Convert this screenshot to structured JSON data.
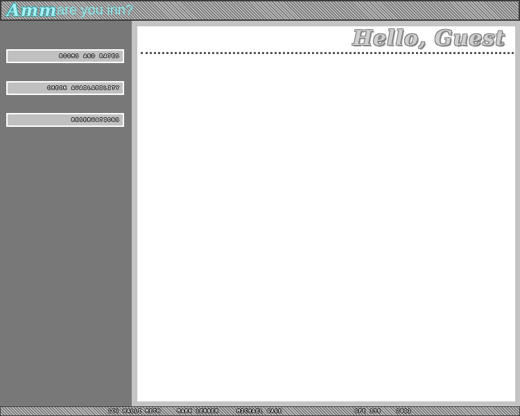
{
  "header": {
    "logo_text": "Amm",
    "tagline": "are you inn?"
  },
  "nav": {
    "items": [
      {
        "label": "ROOMS AND RATES"
      },
      {
        "label": "CHECK AVAILABILITY"
      },
      {
        "label": "RESERVATIONS"
      }
    ]
  },
  "main": {
    "greeting": "Hello, Guest"
  },
  "footer": {
    "copyright": "(C) HALLI METH",
    "author2": "MARK LERNER",
    "author3": "MICHAEL GAGE",
    "course": "CPE 356",
    "year": "2011"
  }
}
